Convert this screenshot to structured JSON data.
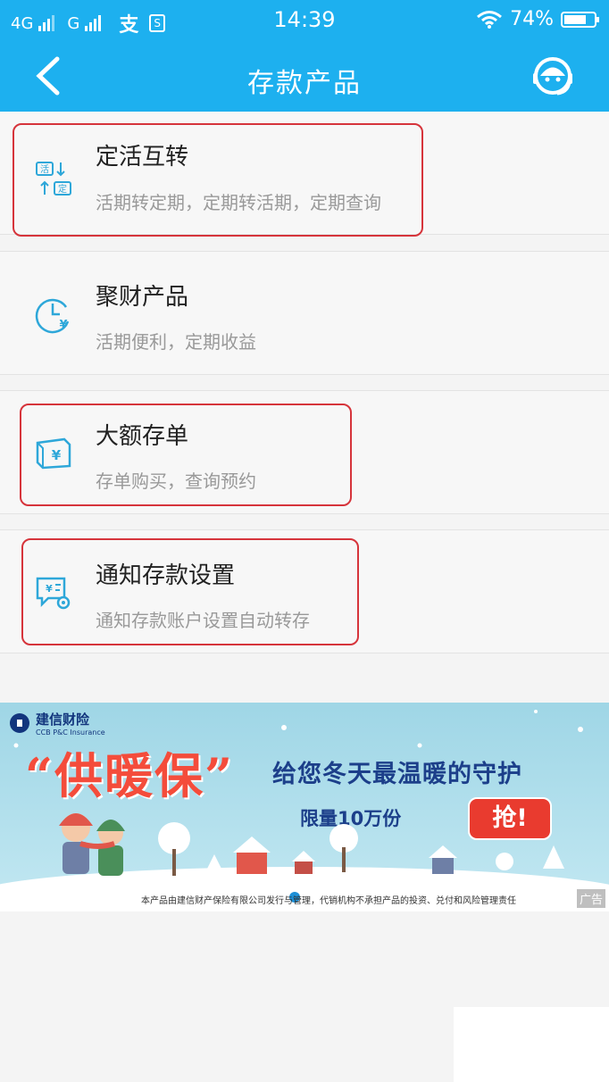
{
  "status_bar": {
    "net1": "4G",
    "net2": "G",
    "time": "14:39",
    "battery_text": "74%",
    "battery_level": 0.74
  },
  "nav": {
    "title": "存款产品"
  },
  "items": [
    {
      "title": "定活互转",
      "subtitle": "活期转定期，定期转活期，定期查询",
      "icon": "exchange-icon"
    },
    {
      "title": "聚财产品",
      "subtitle": "活期便利，定期收益",
      "icon": "clock-yen-icon"
    },
    {
      "title": "大额存单",
      "subtitle": "存单购买，查询预约",
      "icon": "certificate-icon"
    },
    {
      "title": "通知存款设置",
      "subtitle": "通知存款账户设置自动转存",
      "icon": "notice-settings-icon"
    }
  ],
  "banner": {
    "brand_cn": "建信财险",
    "brand_en": "CCB P&C Insurance",
    "headline": "“供暖保”",
    "slogan": "给您冬天最温暖的守护",
    "limit_text": "限量10万份",
    "cta": "抢!",
    "disclaimer": "本产品由建信财产保险有限公司发行与管理，代销机构不承担产品的投资、兑付和风险管理责任",
    "ad_tag": "广告",
    "slides_total": 4,
    "active_slide": 2
  },
  "colors": {
    "header": "#1db0ef",
    "highlight": "#d6343b",
    "icon": "#2ea7d9"
  }
}
